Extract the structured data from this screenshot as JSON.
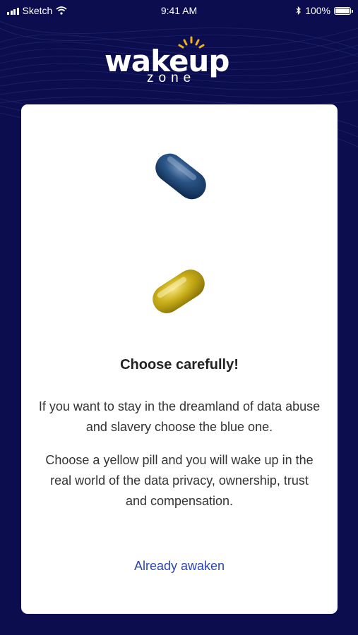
{
  "status_bar": {
    "carrier": "Sketch",
    "time": "9:41 AM",
    "battery": "100%",
    "battery_level": 1.0,
    "icons": [
      "signal-icon",
      "wifi-icon",
      "bluetooth-icon",
      "battery-icon"
    ]
  },
  "logo": {
    "main": "wakeup",
    "sub": "zone"
  },
  "card": {
    "pills": [
      "blue-pill",
      "yellow-pill"
    ],
    "title": "Choose carefully!",
    "paragraph_1": "If you want to stay in the dreamland of data abuse and slavery choose the blue one.",
    "paragraph_2": "Choose a yellow pill and you will wake up in the real world of the data privacy, ownership, trust and compensation.",
    "link": "Already awaken"
  },
  "colors": {
    "background": "#0b0d4f",
    "card": "#ffffff",
    "link": "#2c43b8",
    "logo_accent": "#f2b01e",
    "blue_pill": "#1f4a7a",
    "yellow_pill": "#c9b21e"
  }
}
